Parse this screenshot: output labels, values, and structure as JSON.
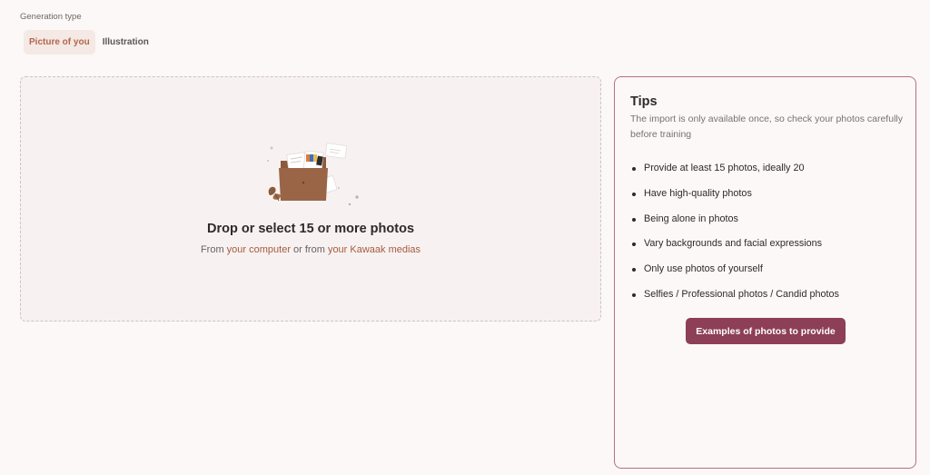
{
  "generation": {
    "label": "Generation type",
    "tabs": [
      {
        "label": "Picture of you",
        "active": true
      },
      {
        "label": "Illustration",
        "active": false
      }
    ]
  },
  "dropzone": {
    "title": "Drop or select 15 or more photos",
    "sub_from": "From ",
    "sub_link_computer": "your computer",
    "sub_or": " or from ",
    "sub_link_medias": "your Kawaak medias",
    "illustration_icon": "folder-with-photos-icon"
  },
  "tips": {
    "title": "Tips",
    "intro": "The import is only available once, so check your photos carefully before training",
    "items": [
      "Provide at least 15 photos, ideally 20",
      "Have high-quality photos",
      "Being alone in photos",
      "Vary backgrounds and facial expressions",
      "Only use photos of yourself",
      "Selfies / Professional photos / Candid photos"
    ],
    "button_label": "Examples of photos to provide"
  },
  "colors": {
    "accent_tab": "#b5654a",
    "link": "#a65a3f",
    "button": "#8c3f56",
    "tips_border": "#b3727f"
  }
}
